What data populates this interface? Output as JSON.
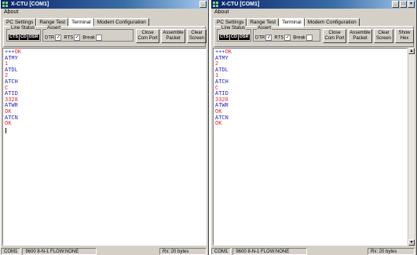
{
  "windows": [
    {
      "title": "X-CTU [COM1]",
      "menu": "About",
      "tabs": [
        "PC Settings",
        "Range Test",
        "Terminal",
        "Modem Configuration"
      ],
      "active_tab": "Terminal",
      "line_status": {
        "label": "Line Status",
        "leds": [
          "CTS",
          "CD",
          "DSR"
        ]
      },
      "assert": {
        "label": "Assert",
        "dtr": "DTR",
        "rts": "RTS",
        "brk": "Break"
      },
      "buttons": {
        "close": "Close Com Port",
        "assemble": "Assemble Packet",
        "clear": "Clear Screen"
      },
      "terminal": [
        {
          "text": "+++OK",
          "dir": "mixed",
          "tx": "+++",
          "rx": "OK"
        },
        {
          "text": "ATMY",
          "dir": "tx"
        },
        {
          "text": "1",
          "dir": "rx"
        },
        {
          "text": "ATDL",
          "dir": "tx"
        },
        {
          "text": "2",
          "dir": "rx"
        },
        {
          "text": "ATCH",
          "dir": "tx"
        },
        {
          "text": "C",
          "dir": "rx"
        },
        {
          "text": "ATID",
          "dir": "tx"
        },
        {
          "text": "3328",
          "dir": "rx"
        },
        {
          "text": "ATWR",
          "dir": "tx"
        },
        {
          "text": "OK",
          "dir": "rx"
        },
        {
          "text": "ATCN",
          "dir": "tx"
        },
        {
          "text": "OK",
          "dir": "rx"
        }
      ],
      "status": {
        "port": "COM1",
        "settings": "9600 8-N-1  FLOW:NONE",
        "rx": "Rx: 20 bytes"
      }
    },
    {
      "title": "X-CTU [COM1]",
      "menu": "About",
      "tabs": [
        "PC Settings",
        "Range Test",
        "Terminal",
        "Modem Configuration"
      ],
      "active_tab": "Terminal",
      "line_status": {
        "label": "Line Status",
        "leds": [
          "CTS",
          "CD",
          "DSR"
        ]
      },
      "assert": {
        "label": "Assert",
        "dtr": "DTR",
        "rts": "RTS",
        "brk": "Break"
      },
      "buttons": {
        "close": "Close Com Port",
        "assemble": "Assemble Packet",
        "clear": "Clear Screen",
        "show_hex": "Show Hex"
      },
      "terminal": [
        {
          "text": "+++OK",
          "dir": "mixed",
          "tx": "+++",
          "rx": "OK"
        },
        {
          "text": "ATMY",
          "dir": "tx"
        },
        {
          "text": "2",
          "dir": "rx"
        },
        {
          "text": "ATDL",
          "dir": "tx"
        },
        {
          "text": "1",
          "dir": "rx"
        },
        {
          "text": "ATCH",
          "dir": "tx"
        },
        {
          "text": "C",
          "dir": "rx"
        },
        {
          "text": "ATID",
          "dir": "tx"
        },
        {
          "text": "3328",
          "dir": "rx"
        },
        {
          "text": "ATWR",
          "dir": "tx"
        },
        {
          "text": "OK",
          "dir": "rx"
        },
        {
          "text": "ATCN",
          "dir": "tx"
        },
        {
          "text": "OK",
          "dir": "rx"
        }
      ],
      "status": {
        "port": "COM1",
        "settings": "9600 8-N-1  FLOW:NONE",
        "rx": "Rx: 20 bytes"
      }
    }
  ],
  "colors": {
    "tx": "#1a1ab8",
    "rx": "#e0202a",
    "titlebar": "#0a246a",
    "chrome": "#d4d0c8"
  }
}
